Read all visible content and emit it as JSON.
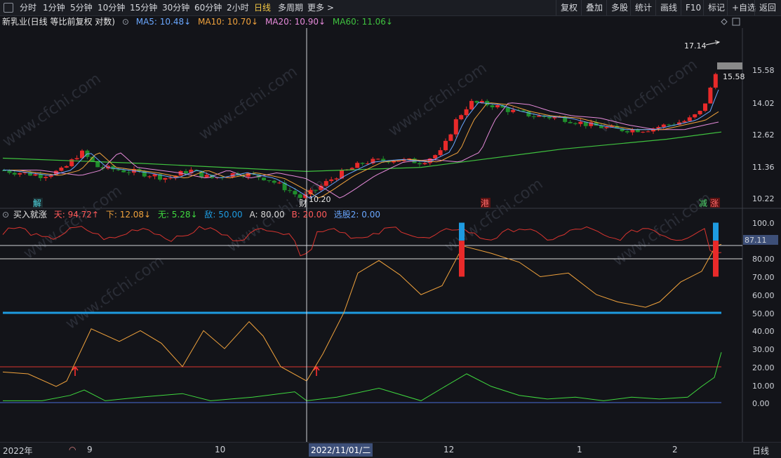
{
  "toolbar": {
    "periods": [
      "分时",
      "1分钟",
      "5分钟",
      "10分钟",
      "15分钟",
      "30分钟",
      "60分钟",
      "2小时",
      "日线",
      "多周期",
      "更多 >"
    ],
    "active_period": "日线",
    "right_buttons": [
      "复权",
      "叠加",
      "多股",
      "统计",
      "画线",
      "F10",
      "标记",
      "+自选",
      "返回"
    ]
  },
  "main_legend": {
    "stock": "新乳业(日线 等比前复权 对数)",
    "ma5": "MA5: 10.48↓",
    "ma10": "MA10: 10.70↓",
    "ma20": "MA20: 10.90↓",
    "ma60": "MA60: 11.06↓",
    "colors": {
      "ma5": "#6aa7ff",
      "ma10": "#f0a23c",
      "ma20": "#e58ad9",
      "ma60": "#3fc23f"
    }
  },
  "main_yaxis": [
    "15.58",
    "14.02",
    "12.62",
    "11.36",
    "10.22"
  ],
  "price_marks": {
    "high": "17.14",
    "last": "15.58",
    "low": "10.20"
  },
  "event_tags": {
    "jie": "解",
    "cai": "财",
    "gang": "港",
    "jian": "减",
    "zhang": "涨"
  },
  "sub_legend": {
    "name": "买入就涨",
    "tian": "天: 94.72↑",
    "xia": "下: 12.08↓",
    "wu": "无: 5.28↓",
    "di": "敌: 50.00",
    "a": "A: 80.00",
    "b": "B: 20.00",
    "xg": "选股2: 0.00"
  },
  "sub_yaxis": [
    "100.0",
    "90.00",
    "80.00",
    "70.00",
    "60.00",
    "50.00",
    "40.00",
    "30.00",
    "20.00",
    "10.00",
    "0.00"
  ],
  "sub_cursor_value": "87.11",
  "xaxis": {
    "year": "2022年",
    "m9": "9",
    "m10": "10",
    "date": "2022/11/01/二",
    "m12": "12",
    "m1": "1",
    "m2": "2",
    "period": "日线"
  },
  "watermark": "www.cfchi.com",
  "colors": {
    "up": "#e82a2a",
    "down": "#1f8e2c",
    "tian": "#d9342f",
    "xia": "#f0a23c",
    "wu": "#3fd93f",
    "di": "#1e9be0",
    "bg": "#131419"
  }
}
